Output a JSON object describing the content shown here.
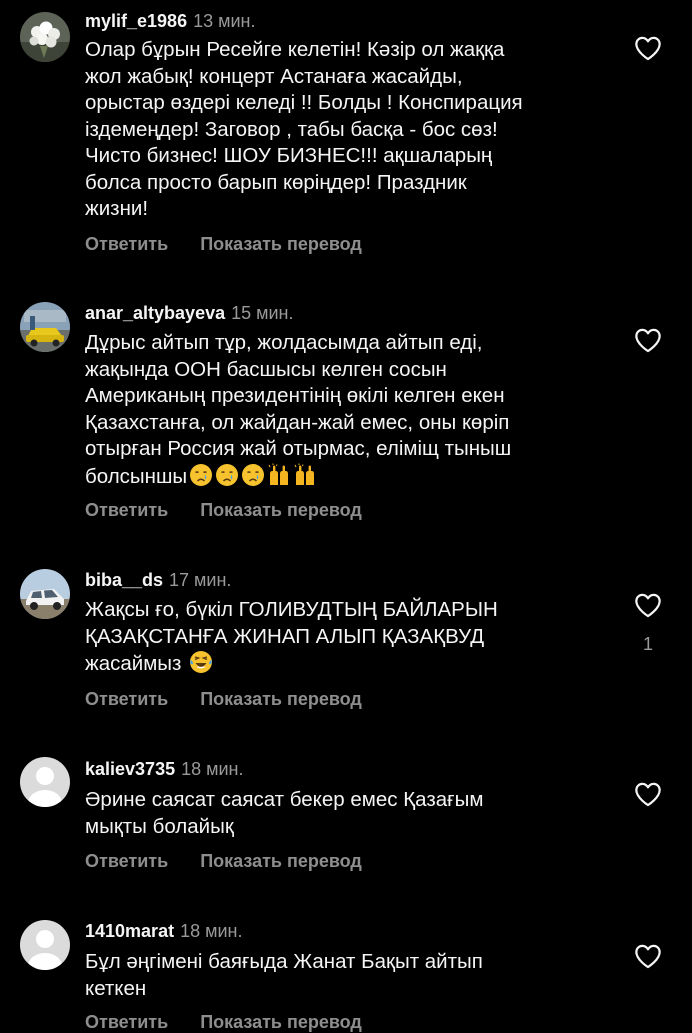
{
  "labels": {
    "reply": "Ответить",
    "translate": "Показать перевод"
  },
  "comments": [
    {
      "username": "mylif_e1986",
      "time": "13 мин.",
      "avatar": "flowers-photo-avatar",
      "text_lines": [
        "Олар бұрын Ресейге келетін! Кәзір ол жаққа",
        "жол жабық! концерт Астанаға жасайды,",
        "орыстар өздері келеді !! Болды ! Конспирация",
        "іздемеңдер! Заговор , табы басқа - бос сөз!",
        "Чисто бизнес! ШОУ БИЗНЕС!!! ақшаларың",
        "болса просто барып көріңдер! Праздник",
        "жизни!"
      ],
      "likes": ""
    },
    {
      "username": "anar_altybayeva",
      "time": "15 мин.",
      "avatar": "yellow-car-photo-avatar",
      "text_lines": [
        "Дұрыс айтып тұр, жолдасымда айтып еді,",
        "жақында ООН басшысы келген сосын",
        "Американың президентінің өкілі келген екен",
        "Қазахстанға, ол жайдан-жай емес, оны көріп",
        "отырған Россия жай отырмас, еліміщ тыныш",
        "болсыншы"
      ],
      "emojis": [
        "crying-face-emoji",
        "crying-face-emoji",
        "crying-face-emoji",
        "raising-hands-emoji",
        "raising-hands-emoji"
      ],
      "likes": ""
    },
    {
      "username": "biba__ds",
      "time": "17 мин.",
      "avatar": "white-car-photo-avatar",
      "text_lines": [
        "Жақсы ғо, бүкіл ГОЛИВУДТЫҢ БАЙЛАРЫН",
        "ҚАЗАҚСТАНҒА ЖИНАП АЛЫП ҚАЗАҚВУД",
        "жасаймыз"
      ],
      "emojis": [
        "tears-of-joy-emoji"
      ],
      "likes": "1"
    },
    {
      "username": "kaliev3735",
      "time": "18 мин.",
      "avatar": "default-avatar",
      "text_lines": [
        "Әрине саясат саясат бекер емес Қазағым",
        "мықты болайық"
      ],
      "likes": ""
    },
    {
      "username": "1410marat",
      "time": "18 мин.",
      "avatar": "default-avatar",
      "text_lines": [
        "Бұл әңгімені баяғыда Жанат Бақыт айтып",
        "кеткен"
      ],
      "likes": ""
    }
  ],
  "colors": {
    "background": "#000000",
    "text": "#f5f5f5",
    "muted": "#8e8e8e",
    "default_avatar_bg": "#dbdbdb"
  }
}
